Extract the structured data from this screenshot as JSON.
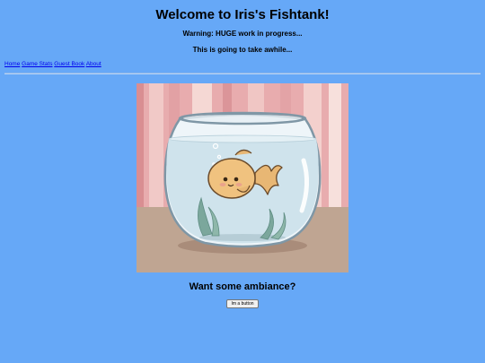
{
  "page": {
    "title": "Welcome to Iris's Fishtank!",
    "warning": "Warning: HUGE work in progress...",
    "note": "This is going to take awhile..."
  },
  "nav": {
    "items": [
      {
        "label": "Home"
      },
      {
        "label": "Game Stats"
      },
      {
        "label": "Guest Book"
      },
      {
        "label": "About"
      }
    ]
  },
  "ambiance": {
    "heading": "Want some ambiance?",
    "button_label": "Im a button"
  },
  "colors": {
    "background": "#66a8f7",
    "link": "#0000ee"
  },
  "image": {
    "subject": "goldfish-in-bowl-illustration"
  }
}
